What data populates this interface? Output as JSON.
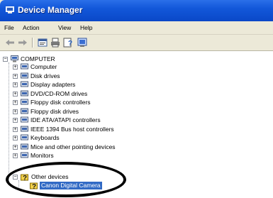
{
  "window": {
    "title": "Device Manager"
  },
  "menu": {
    "file": "File",
    "action": "Action",
    "view": "View",
    "help": "Help"
  },
  "tree": {
    "root": "COMPUTER",
    "items": [
      "Computer",
      "Disk drives",
      "Display adapters",
      "DVD/CD-ROM drives",
      "Floppy disk controllers",
      "Floppy disk drives",
      "IDE ATA/ATAPI controllers",
      "IEEE 1394 Bus host controllers",
      "Keyboards",
      "Mice and other pointing devices",
      "Monitors"
    ],
    "other_devices": "Other devices",
    "selected_child": "Canon Digital Camera"
  },
  "colors": {
    "title_bar": "#0a48c8",
    "selection": "#316ac5",
    "highlight_ring": "#000000"
  }
}
